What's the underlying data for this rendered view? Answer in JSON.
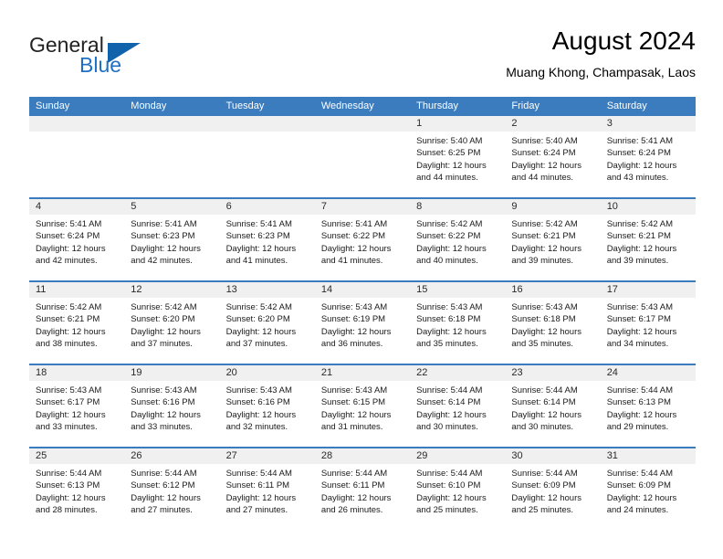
{
  "brand": {
    "name_part1": "General",
    "name_part2": "Blue",
    "accent_color": "#1062aa",
    "triangle_icon": "triangle-icon"
  },
  "header": {
    "title": "August 2024",
    "subtitle": "Muang Khong, Champasak, Laos"
  },
  "calendar": {
    "header_bg": "#3a7cbe",
    "daynum_bg": "#f0f0f0",
    "weekdays": [
      "Sunday",
      "Monday",
      "Tuesday",
      "Wednesday",
      "Thursday",
      "Friday",
      "Saturday"
    ],
    "weeks": [
      [
        {
          "day": "",
          "empty": true,
          "sunrise": "",
          "sunset": "",
          "daylight": ""
        },
        {
          "day": "",
          "empty": true,
          "sunrise": "",
          "sunset": "",
          "daylight": ""
        },
        {
          "day": "",
          "empty": true,
          "sunrise": "",
          "sunset": "",
          "daylight": ""
        },
        {
          "day": "",
          "empty": true,
          "sunrise": "",
          "sunset": "",
          "daylight": ""
        },
        {
          "day": "1",
          "empty": false,
          "sunrise": "Sunrise: 5:40 AM",
          "sunset": "Sunset: 6:25 PM",
          "daylight": "Daylight: 12 hours and 44 minutes."
        },
        {
          "day": "2",
          "empty": false,
          "sunrise": "Sunrise: 5:40 AM",
          "sunset": "Sunset: 6:24 PM",
          "daylight": "Daylight: 12 hours and 44 minutes."
        },
        {
          "day": "3",
          "empty": false,
          "sunrise": "Sunrise: 5:41 AM",
          "sunset": "Sunset: 6:24 PM",
          "daylight": "Daylight: 12 hours and 43 minutes."
        }
      ],
      [
        {
          "day": "4",
          "empty": false,
          "sunrise": "Sunrise: 5:41 AM",
          "sunset": "Sunset: 6:24 PM",
          "daylight": "Daylight: 12 hours and 42 minutes."
        },
        {
          "day": "5",
          "empty": false,
          "sunrise": "Sunrise: 5:41 AM",
          "sunset": "Sunset: 6:23 PM",
          "daylight": "Daylight: 12 hours and 42 minutes."
        },
        {
          "day": "6",
          "empty": false,
          "sunrise": "Sunrise: 5:41 AM",
          "sunset": "Sunset: 6:23 PM",
          "daylight": "Daylight: 12 hours and 41 minutes."
        },
        {
          "day": "7",
          "empty": false,
          "sunrise": "Sunrise: 5:41 AM",
          "sunset": "Sunset: 6:22 PM",
          "daylight": "Daylight: 12 hours and 41 minutes."
        },
        {
          "day": "8",
          "empty": false,
          "sunrise": "Sunrise: 5:42 AM",
          "sunset": "Sunset: 6:22 PM",
          "daylight": "Daylight: 12 hours and 40 minutes."
        },
        {
          "day": "9",
          "empty": false,
          "sunrise": "Sunrise: 5:42 AM",
          "sunset": "Sunset: 6:21 PM",
          "daylight": "Daylight: 12 hours and 39 minutes."
        },
        {
          "day": "10",
          "empty": false,
          "sunrise": "Sunrise: 5:42 AM",
          "sunset": "Sunset: 6:21 PM",
          "daylight": "Daylight: 12 hours and 39 minutes."
        }
      ],
      [
        {
          "day": "11",
          "empty": false,
          "sunrise": "Sunrise: 5:42 AM",
          "sunset": "Sunset: 6:21 PM",
          "daylight": "Daylight: 12 hours and 38 minutes."
        },
        {
          "day": "12",
          "empty": false,
          "sunrise": "Sunrise: 5:42 AM",
          "sunset": "Sunset: 6:20 PM",
          "daylight": "Daylight: 12 hours and 37 minutes."
        },
        {
          "day": "13",
          "empty": false,
          "sunrise": "Sunrise: 5:42 AM",
          "sunset": "Sunset: 6:20 PM",
          "daylight": "Daylight: 12 hours and 37 minutes."
        },
        {
          "day": "14",
          "empty": false,
          "sunrise": "Sunrise: 5:43 AM",
          "sunset": "Sunset: 6:19 PM",
          "daylight": "Daylight: 12 hours and 36 minutes."
        },
        {
          "day": "15",
          "empty": false,
          "sunrise": "Sunrise: 5:43 AM",
          "sunset": "Sunset: 6:18 PM",
          "daylight": "Daylight: 12 hours and 35 minutes."
        },
        {
          "day": "16",
          "empty": false,
          "sunrise": "Sunrise: 5:43 AM",
          "sunset": "Sunset: 6:18 PM",
          "daylight": "Daylight: 12 hours and 35 minutes."
        },
        {
          "day": "17",
          "empty": false,
          "sunrise": "Sunrise: 5:43 AM",
          "sunset": "Sunset: 6:17 PM",
          "daylight": "Daylight: 12 hours and 34 minutes."
        }
      ],
      [
        {
          "day": "18",
          "empty": false,
          "sunrise": "Sunrise: 5:43 AM",
          "sunset": "Sunset: 6:17 PM",
          "daylight": "Daylight: 12 hours and 33 minutes."
        },
        {
          "day": "19",
          "empty": false,
          "sunrise": "Sunrise: 5:43 AM",
          "sunset": "Sunset: 6:16 PM",
          "daylight": "Daylight: 12 hours and 33 minutes."
        },
        {
          "day": "20",
          "empty": false,
          "sunrise": "Sunrise: 5:43 AM",
          "sunset": "Sunset: 6:16 PM",
          "daylight": "Daylight: 12 hours and 32 minutes."
        },
        {
          "day": "21",
          "empty": false,
          "sunrise": "Sunrise: 5:43 AM",
          "sunset": "Sunset: 6:15 PM",
          "daylight": "Daylight: 12 hours and 31 minutes."
        },
        {
          "day": "22",
          "empty": false,
          "sunrise": "Sunrise: 5:44 AM",
          "sunset": "Sunset: 6:14 PM",
          "daylight": "Daylight: 12 hours and 30 minutes."
        },
        {
          "day": "23",
          "empty": false,
          "sunrise": "Sunrise: 5:44 AM",
          "sunset": "Sunset: 6:14 PM",
          "daylight": "Daylight: 12 hours and 30 minutes."
        },
        {
          "day": "24",
          "empty": false,
          "sunrise": "Sunrise: 5:44 AM",
          "sunset": "Sunset: 6:13 PM",
          "daylight": "Daylight: 12 hours and 29 minutes."
        }
      ],
      [
        {
          "day": "25",
          "empty": false,
          "sunrise": "Sunrise: 5:44 AM",
          "sunset": "Sunset: 6:13 PM",
          "daylight": "Daylight: 12 hours and 28 minutes."
        },
        {
          "day": "26",
          "empty": false,
          "sunrise": "Sunrise: 5:44 AM",
          "sunset": "Sunset: 6:12 PM",
          "daylight": "Daylight: 12 hours and 27 minutes."
        },
        {
          "day": "27",
          "empty": false,
          "sunrise": "Sunrise: 5:44 AM",
          "sunset": "Sunset: 6:11 PM",
          "daylight": "Daylight: 12 hours and 27 minutes."
        },
        {
          "day": "28",
          "empty": false,
          "sunrise": "Sunrise: 5:44 AM",
          "sunset": "Sunset: 6:11 PM",
          "daylight": "Daylight: 12 hours and 26 minutes."
        },
        {
          "day": "29",
          "empty": false,
          "sunrise": "Sunrise: 5:44 AM",
          "sunset": "Sunset: 6:10 PM",
          "daylight": "Daylight: 12 hours and 25 minutes."
        },
        {
          "day": "30",
          "empty": false,
          "sunrise": "Sunrise: 5:44 AM",
          "sunset": "Sunset: 6:09 PM",
          "daylight": "Daylight: 12 hours and 25 minutes."
        },
        {
          "day": "31",
          "empty": false,
          "sunrise": "Sunrise: 5:44 AM",
          "sunset": "Sunset: 6:09 PM",
          "daylight": "Daylight: 12 hours and 24 minutes."
        }
      ]
    ]
  }
}
